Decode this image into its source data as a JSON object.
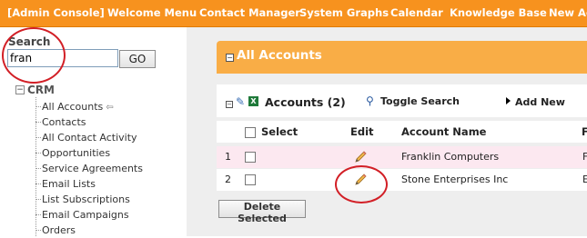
{
  "nav": {
    "items": [
      "[Admin Console]",
      "Welcome Menu",
      "Contact Manager",
      "System Graphs",
      "Calendar",
      "Knowledge Base",
      "New Ac"
    ]
  },
  "sidebar": {
    "search_label": "Search",
    "search_value": "fran",
    "go_label": "GO",
    "tree_root": "CRM",
    "items": [
      "All Accounts",
      "Contacts",
      "All Contact Activity",
      "Opportunities",
      "Service Agreements",
      "Email Lists",
      "List Subscriptions",
      "Email Campaigns",
      "Orders"
    ]
  },
  "panel": {
    "title": "All Accounts",
    "accounts_title": "Accounts (2)",
    "toggle_search": "Toggle Search",
    "add_new": "Add New"
  },
  "table": {
    "headers": [
      "Select",
      "Edit",
      "Account Name",
      "F"
    ],
    "rows": [
      {
        "num": "1",
        "name": "Franklin Computers",
        "extra": "F"
      },
      {
        "num": "2",
        "name": "Stone Enterprises Inc",
        "extra": "E"
      }
    ],
    "delete_label": "Delete Selected"
  },
  "colors": {
    "nav_bg": "#f7921e",
    "panel_head": "#f9ad46",
    "annotation": "#d21f26"
  }
}
